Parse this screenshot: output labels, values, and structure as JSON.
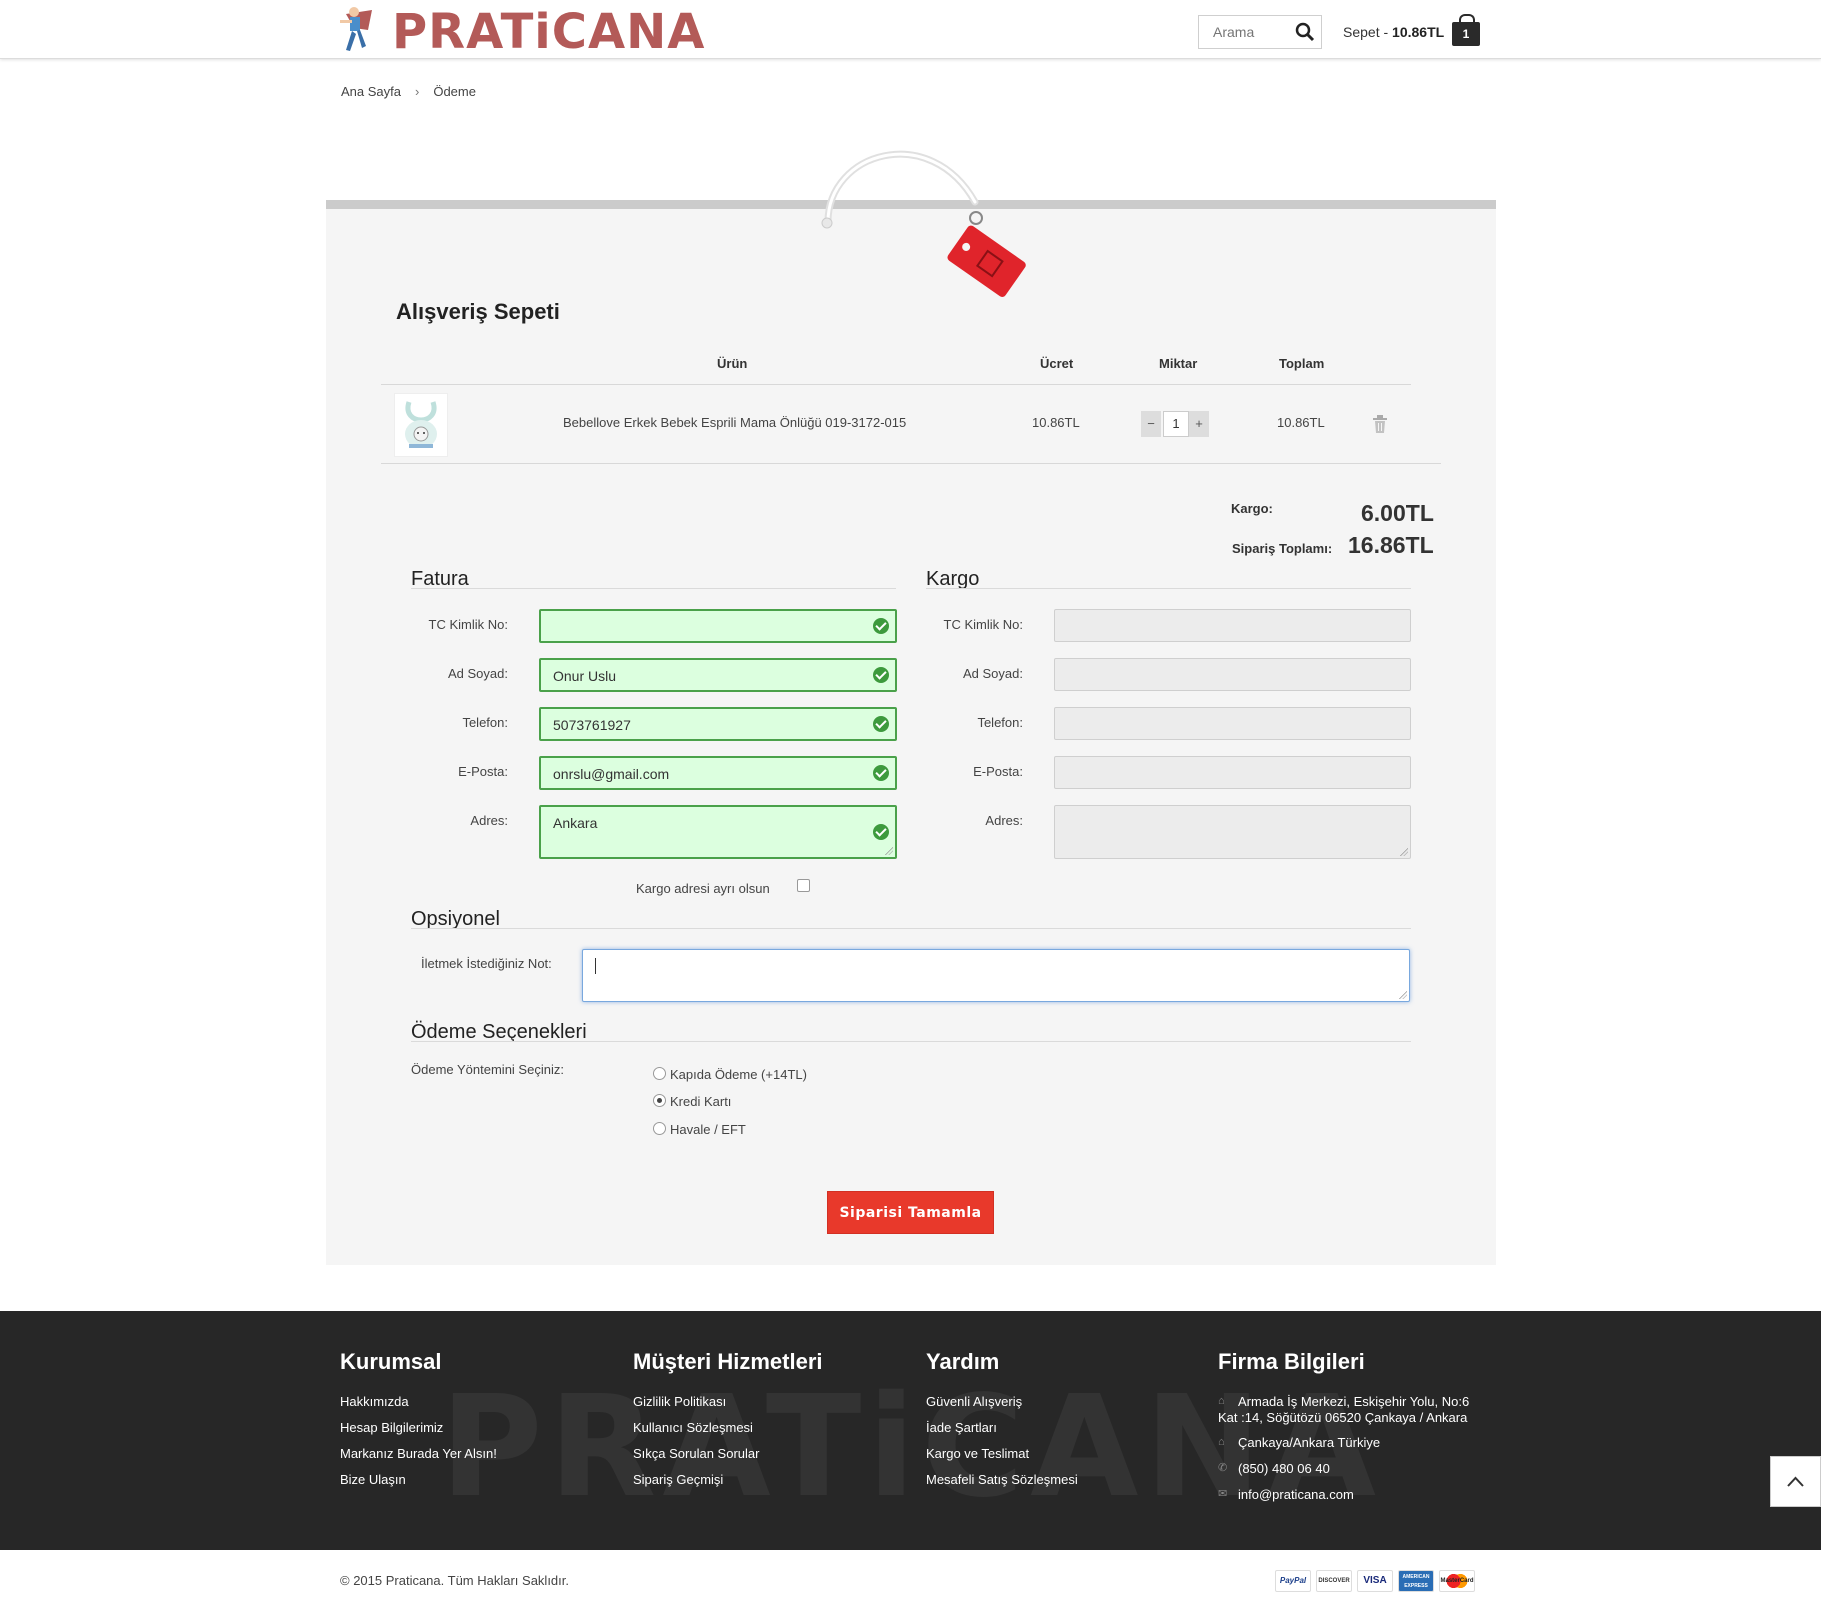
{
  "header": {
    "logo_text": "PRATiCANA",
    "search_placeholder": "Arama",
    "cart_label": "Sepet - ",
    "cart_total": "10.86TL",
    "cart_count": "1"
  },
  "breadcrumb": {
    "home": "Ana Sayfa",
    "separator": "›",
    "current": "Ödeme"
  },
  "cart": {
    "title": "Alışveriş Sepeti",
    "columns": {
      "product": "Ürün",
      "price": "Ücret",
      "quantity": "Miktar",
      "total": "Toplam"
    },
    "items": [
      {
        "name": "Bebellove Erkek Bebek Esprili Mama Önlüğü 019-3172-015",
        "price": "10.86TL",
        "quantity": "1",
        "total": "10.86TL"
      }
    ],
    "qty_minus": "−",
    "qty_plus": "+",
    "shipping_label": "Kargo:",
    "shipping_value": "6.00TL",
    "order_total_label": "Sipariş Toplamı:",
    "order_total_value": "16.86TL"
  },
  "billing": {
    "title": "Fatura",
    "labels": {
      "tc": "TC Kimlik No:",
      "name": "Ad Soyad:",
      "phone": "Telefon:",
      "email": "E-Posta:",
      "address": "Adres:"
    },
    "values": {
      "tc": "",
      "name": "Onur Uslu",
      "phone": "5073761927",
      "email": "onrslu@gmail.com",
      "address": "Ankara"
    },
    "separate_shipping_label": "Kargo adresi ayrı olsun"
  },
  "shipping": {
    "title": "Kargo",
    "labels": {
      "tc": "TC Kimlik No:",
      "name": "Ad Soyad:",
      "phone": "Telefon:",
      "email": "E-Posta:",
      "address": "Adres:"
    }
  },
  "optional": {
    "title": "Opsiyonel",
    "note_label": "İletmek İstediğiniz Not:",
    "note_value": ""
  },
  "payment": {
    "title": "Ödeme Seçenekleri",
    "select_label": "Ödeme Yöntemini Seçiniz:",
    "options": [
      "Kapıda Ödeme (+14TL)",
      "Kredi Kartı",
      "Havale / EFT"
    ],
    "selected": "Kredi Kartı",
    "submit": "Siparisi Tamamla"
  },
  "footer": {
    "watermark": "PRATiCANA",
    "corporate": {
      "title": "Kurumsal",
      "links": [
        "Hakkımızda",
        "Hesap Bilgilerimiz",
        "Markanız Burada Yer Alsın!",
        "Bize Ulaşın"
      ]
    },
    "customer": {
      "title": "Müşteri Hizmetleri",
      "links": [
        "Gizlilik Politikası",
        "Kullanıcı Sözleşmesi",
        "Sıkça Sorulan Sorular",
        "Sipariş Geçmişi"
      ]
    },
    "help": {
      "title": "Yardım",
      "links": [
        "Güvenli Alışveriş",
        "İade Şartları",
        "Kargo ve Teslimat",
        "Mesafeli Satış Sözleşmesi"
      ]
    },
    "company": {
      "title": "Firma Bilgileri",
      "address_line1": "Armada İş Merkezi, Eskişehir Yolu, No:6",
      "address_line2": "Kat :14, Söğütözü 06520 Çankaya / Ankara",
      "city": "Çankaya/Ankara Türkiye",
      "phone": "(850) 480 06 40",
      "email": "info@praticana.com"
    }
  },
  "bottom": {
    "copyright": "© 2015 Praticana. Tüm Hakları Saklıdır.",
    "payment_logos": [
      "PayPal",
      "DISCOVER",
      "VISA",
      "AMERICAN EXPRESS",
      "MasterCard"
    ]
  },
  "colors": {
    "brand": "#b35a58",
    "accent_button": "#e8392b",
    "valid_field": "#dcffdf",
    "footer_bg": "#272727"
  }
}
